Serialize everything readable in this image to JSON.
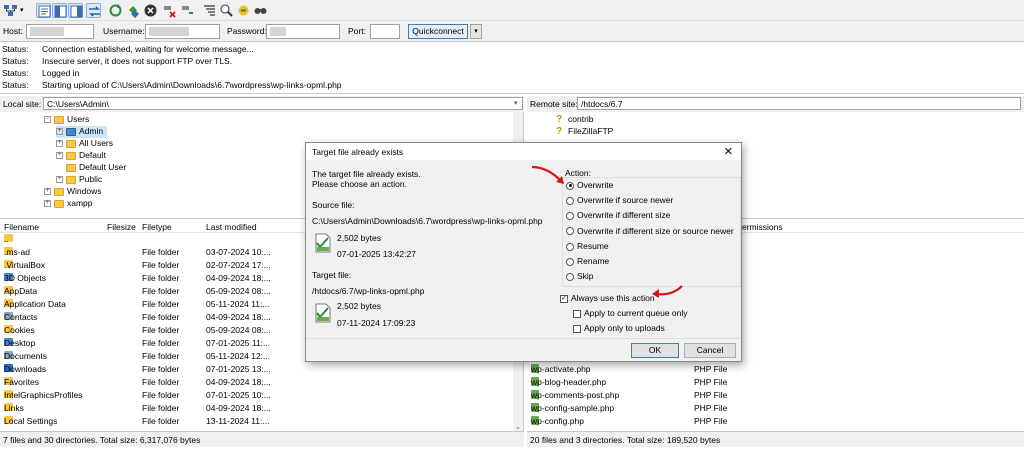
{
  "toolbar": {
    "icons": [
      "site-manager-icon",
      "toggle-log-icon",
      "toggle-local-tree-icon",
      "toggle-remote-tree-icon",
      "toggle-queue-icon",
      "refresh-icon",
      "process-queue-icon",
      "cancel-icon",
      "disconnect-icon",
      "reconnect-icon",
      "filter-icon",
      "compare-icon",
      "sync-browse-icon",
      "search-icon"
    ]
  },
  "quickconnect": {
    "host_label": "Host:",
    "username_label": "Username:",
    "password_label": "Password:",
    "port_label": "Port:",
    "button_label": "Quickconnect",
    "dropdown_glyph": "▾"
  },
  "log": [
    {
      "kind": "Status:",
      "text": "Connection established, waiting for welcome message..."
    },
    {
      "kind": "Status:",
      "text": "Insecure server, it does not support FTP over TLS."
    },
    {
      "kind": "Status:",
      "text": "Logged in"
    },
    {
      "kind": "Status:",
      "text": "Starting upload of C:\\Users\\Admin\\Downloads\\6.7\\wordpress\\wp-links-opml.php"
    }
  ],
  "local": {
    "site_label": "Local site:",
    "site_path": "C:\\Users\\Admin\\",
    "tree": [
      {
        "label": "Users",
        "expander": "⊟"
      },
      {
        "label": "Admin",
        "expander": "⊞"
      },
      {
        "label": "All Users",
        "expander": "⊞"
      },
      {
        "label": "Default",
        "expander": "⊞"
      },
      {
        "label": "Default User",
        "expander": ""
      },
      {
        "label": "Public",
        "expander": "⊞"
      },
      {
        "label": "Windows",
        "expander": "⊞"
      },
      {
        "label": "xampp",
        "expander": "⊞"
      }
    ],
    "columns": {
      "filename": "Filename",
      "filesize": "Filesize",
      "filetype": "Filetype",
      "modified": "Last modified"
    },
    "files": [
      {
        "name": "..",
        "type": "",
        "modified": ""
      },
      {
        "name": ".ms-ad",
        "type": "File folder",
        "modified": "03-07-2024 10:..."
      },
      {
        "name": ".VirtualBox",
        "type": "File folder",
        "modified": "02-07-2024 17:..."
      },
      {
        "name": "3D Objects",
        "type": "File folder",
        "modified": "04-09-2024 18:..."
      },
      {
        "name": "AppData",
        "type": "File folder",
        "modified": "05-09-2024 08:..."
      },
      {
        "name": "Application Data",
        "type": "File folder",
        "modified": "05-11-2024 11:..."
      },
      {
        "name": "Contacts",
        "type": "File folder",
        "modified": "04-09-2024 18:..."
      },
      {
        "name": "Cookies",
        "type": "File folder",
        "modified": "05-09-2024 08:..."
      },
      {
        "name": "Desktop",
        "type": "File folder",
        "modified": "07-01-2025 11:..."
      },
      {
        "name": "Documents",
        "type": "File folder",
        "modified": "05-11-2024 12:..."
      },
      {
        "name": "Downloads",
        "type": "File folder",
        "modified": "07-01-2025 13:..."
      },
      {
        "name": "Favorites",
        "type": "File folder",
        "modified": "04-09-2024 18:..."
      },
      {
        "name": "IntelGraphicsProfiles",
        "type": "File folder",
        "modified": "07-01-2025 10:..."
      },
      {
        "name": "Links",
        "type": "File folder",
        "modified": "04-09-2024 18:..."
      },
      {
        "name": "Local Settings",
        "type": "File folder",
        "modified": "13-11-2024 11:..."
      }
    ],
    "status": "7 files and 30 directories. Total size: 6,317,076 bytes"
  },
  "remote": {
    "site_label": "Remote site:",
    "site_path": "/htdocs/6.7",
    "tree": [
      {
        "label": "contrib"
      },
      {
        "label": "FileZillaFTP"
      }
    ],
    "column_permissions": "ermissions",
    "files": [
      {
        "name": "wp-activate.php",
        "type": "PHP File"
      },
      {
        "name": "wp-blog-header.php",
        "type": "PHP File"
      },
      {
        "name": "wp-comments-post.php",
        "type": "PHP File"
      },
      {
        "name": "wp-config-sample.php",
        "type": "PHP File"
      },
      {
        "name": "wp-config.php",
        "type": "PHP File"
      }
    ],
    "status": "20 files and 3 directories. Total size: 189,520 bytes"
  },
  "dialog": {
    "title": "Target file already exists",
    "close_glyph": "✕",
    "intro_line1": "The target file already exists.",
    "intro_line2": "Please choose an action.",
    "source_label": "Source file:",
    "source_path": "C:\\Users\\Admin\\Downloads\\6.7\\wordpress\\wp-links-opml.php",
    "source_size": "2,502 bytes",
    "source_date": "07-01-2025 13:42:27",
    "target_label": "Target file:",
    "target_path": "/htdocs/6.7/wp-links-opml.php",
    "target_size": "2,502 bytes",
    "target_date": "07-11-2024 17:09:23",
    "action_label": "Action:",
    "actions": [
      {
        "label": "Overwrite",
        "selected": true
      },
      {
        "label": "Overwrite if source newer",
        "selected": false
      },
      {
        "label": "Overwrite if different size",
        "selected": false
      },
      {
        "label": "Overwrite if different size or source newer",
        "selected": false
      },
      {
        "label": "Resume",
        "selected": false
      },
      {
        "label": "Rename",
        "selected": false
      },
      {
        "label": "Skip",
        "selected": false
      }
    ],
    "always_use": {
      "label": "Always use this action",
      "checked": true
    },
    "apply_queue": {
      "label": "Apply to current queue only",
      "checked": false
    },
    "apply_uploads": {
      "label": "Apply only to uploads",
      "checked": false
    },
    "ok_label": "OK",
    "cancel_label": "Cancel"
  },
  "colors": {
    "annotation_arrow": "#d0141a",
    "folder": "#f5c84c",
    "selection": "#cce4f7"
  }
}
